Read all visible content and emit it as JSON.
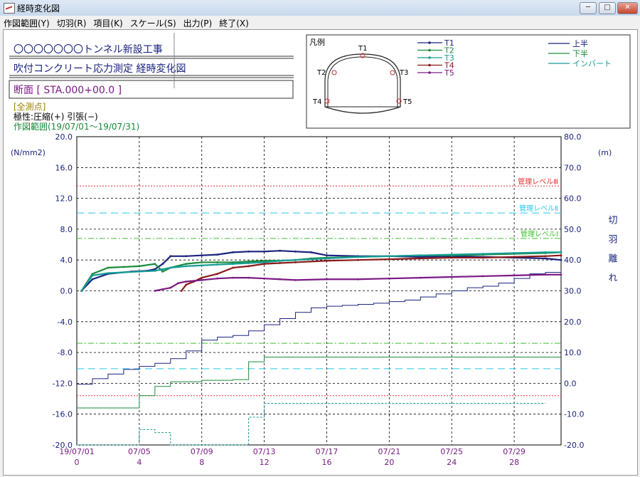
{
  "window": {
    "title": "経時変化図",
    "min": "─",
    "max": "□",
    "close": "✕"
  },
  "menu": [
    "作図範囲(Y)",
    "切羽(R)",
    "項目(K)",
    "スケール(S)",
    "出力(P)",
    "終了(X)"
  ],
  "header": {
    "project": "〇〇〇〇〇〇〇トンネル新設工事",
    "measurement": "吹付コンクリート応力測定 経時変化図",
    "section": "断面 [ STA.000+00.0 ]",
    "all_points": "[全測点]",
    "polarity": "極性:圧縮(+)  引張(−)",
    "range": "作図範囲(19/07/01〜19/07/31)"
  },
  "legend": {
    "title": "凡例",
    "points": [
      {
        "name": "T1",
        "color": "#1a237e"
      },
      {
        "name": "T2",
        "color": "#1b8a3a"
      },
      {
        "name": "T3",
        "color": "#159c95"
      },
      {
        "name": "T4",
        "color": "#8b1a1a"
      },
      {
        "name": "T5",
        "color": "#7b1a85"
      }
    ],
    "faces": [
      {
        "name": "上半",
        "color": "#1a237e"
      },
      {
        "name": "下半",
        "color": "#1b8a3a"
      },
      {
        "name": "インバート",
        "color": "#159c95"
      }
    ]
  },
  "chart_data": {
    "type": "line",
    "xlabel": "",
    "x_tick_labels": [
      {
        "date": "19/07/01",
        "day": "0"
      },
      {
        "date": "07/05",
        "day": "4"
      },
      {
        "date": "07/09",
        "day": "8"
      },
      {
        "date": "07/13",
        "day": "12"
      },
      {
        "date": "07/17",
        "day": "16"
      },
      {
        "date": "07/21",
        "day": "20"
      },
      {
        "date": "07/25",
        "day": "24"
      },
      {
        "date": "07/29",
        "day": "28"
      }
    ],
    "xlim": [
      0,
      31
    ],
    "ylabel": "(N/mm2)",
    "ylim": [
      -20,
      20
    ],
    "yticks": [
      "20.0",
      "16.0",
      "12.0",
      "8.0",
      "4.0",
      "0.0",
      "-4.0",
      "-8.0",
      "-12.0",
      "-16.0",
      "-20.0"
    ],
    "y2label_unit": "(m)",
    "y2label": "切羽離れ",
    "y2lim": [
      -20,
      80
    ],
    "y2ticks": [
      "80.0",
      "70.0",
      "60.0",
      "50.0",
      "40.0",
      "30.0",
      "20.0",
      "10.0",
      "0.0",
      "-10.0",
      "-20.0"
    ],
    "grid": true,
    "management_levels": [
      {
        "name": "管理レベルⅢ",
        "y": 13.6,
        "color": "#e03030"
      },
      {
        "name": "管理レベルⅡ",
        "y": 10.1,
        "color": "#22c8e8"
      },
      {
        "name": "管理レベルⅠ",
        "y": 6.8,
        "color": "#40c030"
      }
    ],
    "lower_levels": [
      {
        "y": -6.8,
        "color": "#40c030"
      },
      {
        "y": -10.1,
        "color": "#22c8e8"
      },
      {
        "y": -13.6,
        "color": "#e03030"
      }
    ],
    "series": [
      {
        "name": "T1",
        "color": "#1a237e",
        "x": [
          0.3,
          1.0,
          2.0,
          3.5,
          4.5,
          5.0,
          5.5,
          6.0,
          7.0,
          8.0,
          9.0,
          10.0,
          11.0,
          12.0,
          13.0,
          14.0,
          15.0,
          16.0,
          18.0,
          20.0,
          22.0,
          24.0,
          26.0,
          28.0,
          30.0,
          31.0
        ],
        "values": [
          0,
          1.5,
          2.2,
          2.5,
          2.6,
          2.8,
          3.5,
          4.5,
          4.5,
          4.6,
          4.7,
          5.0,
          5.1,
          5.1,
          5.2,
          5.1,
          5.0,
          4.6,
          4.5,
          4.5,
          4.4,
          4.5,
          4.4,
          4.3,
          4.2,
          4.0
        ]
      },
      {
        "name": "T2",
        "color": "#1b8a3a",
        "x": [
          0.3,
          1.0,
          2.0,
          3.0,
          4.0,
          5.0,
          5.5,
          6.0,
          7.0,
          8.0,
          9.0,
          10.0,
          11.0,
          12.0,
          13.0,
          14.0,
          15.0,
          16.0,
          18.0,
          20.0,
          22.0,
          24.0,
          26.0,
          28.0,
          30.0,
          31.0
        ],
        "values": [
          0,
          2.2,
          3.0,
          3.1,
          3.2,
          3.5,
          2.5,
          3.0,
          3.5,
          3.7,
          3.7,
          3.7,
          3.8,
          3.9,
          3.9,
          4.0,
          4.2,
          4.3,
          4.4,
          4.5,
          4.6,
          4.6,
          4.7,
          4.8,
          4.9,
          5.0
        ]
      },
      {
        "name": "T3",
        "color": "#159c95",
        "x": [
          0.3,
          1.0,
          2.0,
          3.0,
          4.0,
          5.0,
          5.5,
          6.0,
          7.0,
          8.0,
          9.0,
          10.0,
          11.0,
          12.0,
          13.0,
          14.0,
          16.0,
          18.0,
          20.0,
          22.0,
          24.0,
          26.0,
          28.0,
          30.0,
          31.0
        ],
        "values": [
          0,
          2.0,
          2.3,
          2.4,
          2.5,
          2.6,
          2.8,
          3.0,
          3.2,
          3.3,
          3.4,
          3.5,
          3.6,
          3.7,
          3.9,
          4.0,
          4.2,
          4.4,
          4.5,
          4.6,
          4.7,
          4.8,
          4.9,
          5.0,
          5.0
        ]
      },
      {
        "name": "T4",
        "color": "#8b1a1a",
        "x": [
          6.7,
          7.0,
          7.5,
          8.0,
          9.0,
          10.0,
          11.0,
          12.0,
          13.0,
          14.0,
          16.0,
          18.0,
          20.0,
          22.0,
          24.0,
          26.0,
          28.0,
          30.0,
          31.0
        ],
        "values": [
          0,
          0.8,
          1.2,
          1.7,
          2.2,
          3.0,
          3.2,
          3.5,
          3.6,
          3.7,
          3.9,
          4.0,
          4.1,
          4.2,
          4.3,
          4.3,
          4.4,
          4.5,
          4.6
        ]
      },
      {
        "name": "T5",
        "color": "#7b1a85",
        "x": [
          5.0,
          5.5,
          6.0,
          6.5,
          7.0,
          8.0,
          9.0,
          10.0,
          11.0,
          12.0,
          13.0,
          14.0,
          16.0,
          18.0,
          20.0,
          22.0,
          24.0,
          26.0,
          28.0,
          30.0,
          31.0
        ],
        "values": [
          0,
          0.2,
          0.4,
          1.0,
          1.2,
          1.4,
          1.6,
          1.7,
          1.7,
          1.6,
          1.5,
          1.4,
          1.5,
          1.5,
          1.6,
          1.7,
          1.8,
          1.9,
          2.0,
          2.1,
          2.1
        ]
      }
    ],
    "face_distance": [
      {
        "name": "上半",
        "color": "#1a237e",
        "x": [
          0,
          1,
          2,
          3,
          4,
          5,
          6,
          7,
          8,
          9,
          10,
          11,
          12,
          13,
          14,
          15,
          16,
          17,
          18,
          19,
          20,
          21,
          22,
          23,
          24,
          25,
          26,
          27,
          28,
          29,
          30,
          31
        ],
        "values": [
          -0.3,
          1.5,
          3.0,
          4.5,
          5.5,
          6.5,
          8.0,
          10.5,
          14.0,
          15.0,
          15.5,
          17.0,
          19.0,
          21.0,
          23.0,
          24.5,
          25.0,
          25.3,
          25.6,
          26.0,
          26.5,
          27.0,
          28.0,
          29.0,
          30.0,
          31.0,
          31.5,
          32.5,
          34.0,
          35.5,
          36.0,
          36.5
        ]
      },
      {
        "name": "下半",
        "color": "#1b8a3a",
        "x": [
          0,
          3,
          4,
          5,
          6,
          8,
          10,
          11,
          12,
          14,
          16,
          18,
          20,
          22,
          24,
          26,
          28,
          30,
          31
        ],
        "values": [
          -8.0,
          -8.0,
          -4.0,
          -1.0,
          0.5,
          1.0,
          1.2,
          7.0,
          8.5,
          8.5,
          8.5,
          8.5,
          8.5,
          8.5,
          8.5,
          8.5,
          8.5,
          8.5,
          8.5
        ]
      },
      {
        "name": "インバート",
        "color": "#159c95",
        "x": [
          0,
          3,
          4,
          5,
          6,
          8,
          10,
          11,
          12,
          14,
          16,
          18,
          20,
          22,
          24,
          26,
          28,
          30
        ],
        "values": [
          -20.0,
          -20.0,
          -15.0,
          -16.0,
          -20.0,
          -20.0,
          -20.0,
          -11.0,
          -6.5,
          -6.5,
          -6.5,
          -6.5,
          -6.5,
          -6.5,
          -6.5,
          -6.5,
          -6.5,
          -6.5
        ]
      }
    ]
  }
}
